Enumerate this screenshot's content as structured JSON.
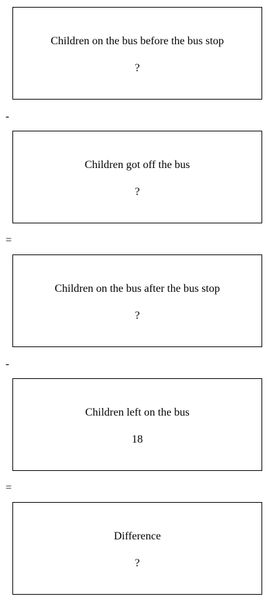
{
  "boxes": [
    {
      "label": "Children on the bus before the bus stop",
      "value": "?"
    },
    {
      "label": "Children got off the bus",
      "value": "?"
    },
    {
      "label": "Children on the bus after the bus stop",
      "value": "?"
    },
    {
      "label": "Children left on the bus",
      "value": "18"
    },
    {
      "label": "Difference",
      "value": "?"
    }
  ],
  "operators": [
    "-",
    "=",
    "-",
    "="
  ]
}
